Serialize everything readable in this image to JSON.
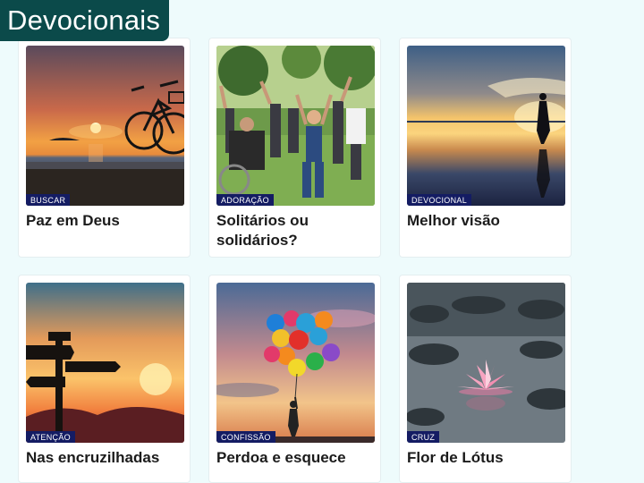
{
  "header": {
    "title": "Devocionais"
  },
  "cards": [
    {
      "title": "Paz em Deus",
      "tag": "BUSCAR",
      "image": "bicycle-sunset-beach"
    },
    {
      "title": "Solitários ou solidários?",
      "tag": "ADORAÇÃO",
      "image": "people-raising-hands-in-park"
    },
    {
      "title": "Melhor visão",
      "tag": "DEVOCIONAL",
      "image": "woman-silhouette-reflection-lake"
    },
    {
      "title": "Nas encruzilhadas",
      "tag": "ATENÇÃO",
      "image": "signpost-silhouette-sunset"
    },
    {
      "title": "Perdoa e esquece",
      "tag": "CONFISSÃO",
      "image": "balloons-released-to-sky"
    },
    {
      "title": "Flor de Lótus",
      "tag": "CRUZ",
      "image": "pink-lotus-flower-water"
    }
  ],
  "colors": {
    "background": "#eefbfc",
    "header_bg": "#0b4a4a",
    "tag_bg": "#141c63",
    "title_text": "#1b1b1b"
  }
}
